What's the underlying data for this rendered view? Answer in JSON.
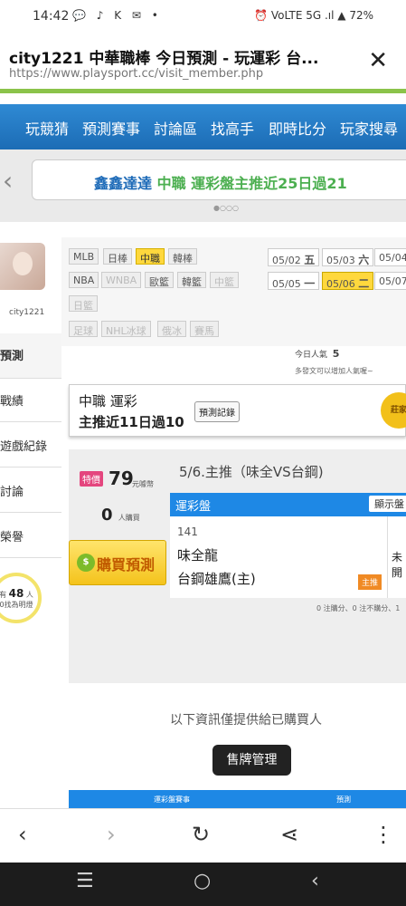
{
  "status_bar": {
    "time": "14:42",
    "battery": "72%",
    "left_icons": "💬 ♪ K ✉ •",
    "right_icons": "⏰ VoLTE 5G .ıl ▲"
  },
  "browser": {
    "title": "city1221 中華職棒 今日預測 - 玩運彩 台...",
    "url": "https://www.playsport.cc/visit_member.php",
    "close_icon": "close-icon"
  },
  "nav": {
    "items": [
      "玩競猜",
      "預測賽事",
      "討論區",
      "找高手",
      "即時比分",
      "玩家搜尋"
    ]
  },
  "banner": {
    "user": "鑫鑫達達",
    "text": "中職 運彩盤主推近25日過21",
    "dots": "●○○○"
  },
  "profile": {
    "username": "city1221"
  },
  "left_tabs": [
    "預測",
    "戰績",
    "遊戲紀錄",
    "討論",
    "榮譽"
  ],
  "bulb": {
    "prefix": "有",
    "count": "48",
    "suffix": "人",
    "text": "0找為明燈"
  },
  "categories": {
    "row1": [
      {
        "label": "MLB",
        "state": "normal"
      },
      {
        "label": "日棒",
        "state": "normal"
      },
      {
        "label": "中職",
        "state": "selected"
      },
      {
        "label": "韓棒",
        "state": "normal"
      }
    ],
    "row2": [
      {
        "label": "NBA",
        "state": "normal"
      },
      {
        "label": "WNBA",
        "state": "dim"
      },
      {
        "label": "歐籃",
        "state": "normal"
      },
      {
        "label": "韓籃",
        "state": "normal"
      },
      {
        "label": "中籃",
        "state": "dim"
      }
    ],
    "row3": [
      {
        "label": "日籃",
        "state": "dim"
      }
    ],
    "row4": [
      {
        "label": "足球",
        "state": "dim"
      },
      {
        "label": "NHL冰球",
        "state": "dim"
      },
      {
        "label": "俄冰",
        "state": "dim"
      },
      {
        "label": "賽馬",
        "state": "dim"
      }
    ]
  },
  "dates": {
    "row1": [
      {
        "d": "05/02",
        "w": "五"
      },
      {
        "d": "05/03",
        "w": "六"
      },
      {
        "d": "05/04",
        "w": ""
      }
    ],
    "row2": [
      {
        "d": "05/05",
        "w": "一"
      },
      {
        "d": "05/06",
        "w": "二",
        "selected": true
      },
      {
        "d": "05/07",
        "w": ""
      }
    ]
  },
  "popularity": {
    "label": "今日人氣",
    "value": "5",
    "hint": "多發文可以增加人氣喔~"
  },
  "record": {
    "line1": "中職 運彩",
    "line2": "主推近11日過10",
    "button": "預測記錄",
    "medal": "莊家"
  },
  "offer": {
    "special": "特價",
    "price": "79",
    "unit": "元噱幣",
    "buyers": "0",
    "buyers_unit": "人購買",
    "buy_button": "購買預測"
  },
  "prediction": {
    "title": "5/6.主推（味全VS台鋼)",
    "odds_header": "運彩盤",
    "show_button": "顯示盤",
    "game_no": "141",
    "team1": "味全龍",
    "team2": "台鋼雄鷹(主)",
    "home_tag": "主推",
    "side_text": "未開",
    "stats": "0 注購分、0 注不購分、1"
  },
  "info_text": "以下資訊僅提供給已購買人",
  "sell_manager": "售牌管理",
  "table_head": {
    "col1": "運彩盤賽事",
    "col2": "預測"
  },
  "browser_nav": {
    "back": "‹",
    "forward": "›",
    "reload": "↻",
    "share": "⋖",
    "menu": "⋮"
  },
  "system_nav": {
    "recents": "☰",
    "home": "○",
    "back": "‹"
  },
  "colors": {
    "nav_blue": "#1c6cb5",
    "accent_yellow": "#ffd83d",
    "banner_green": "#4caf50",
    "odds_blue": "#1e88e5"
  }
}
